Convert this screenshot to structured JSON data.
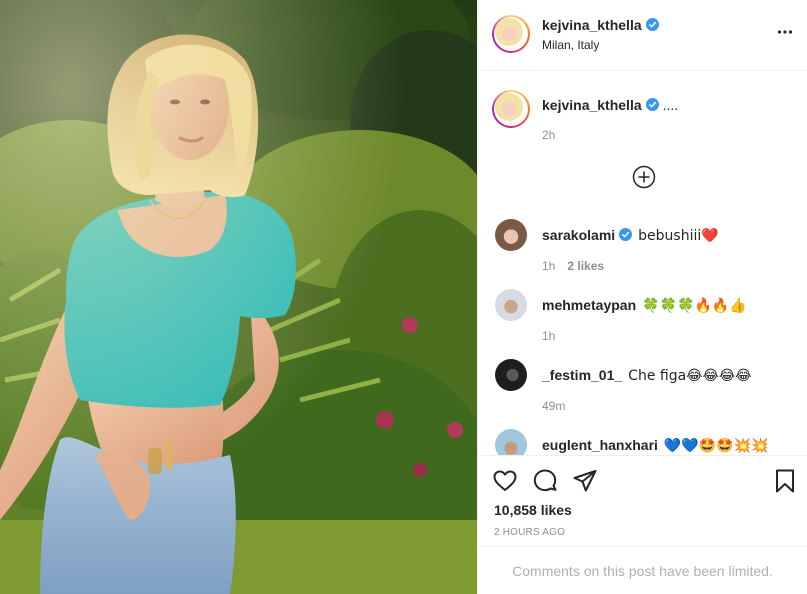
{
  "post": {
    "author": {
      "username": "kejvina_kthella",
      "location": "Milan, Italy",
      "verified": true
    },
    "caption": {
      "text": "....",
      "time": "2h"
    },
    "comments": [
      {
        "username": "sarakolami",
        "verified": true,
        "text": "bebushiii❤️",
        "time": "1h",
        "likes": "2 likes"
      },
      {
        "username": "mehmetaypan",
        "verified": false,
        "text": "🍀🍀🍀🔥🔥👍",
        "time": "1h",
        "likes": ""
      },
      {
        "username": "_festim_01_",
        "verified": false,
        "text": "Che figa😂😂😂😂",
        "time": "49m",
        "likes": ""
      },
      {
        "username": "euglent_hanxhari",
        "verified": false,
        "text": "💙💙🤩🤩💥💥",
        "time": "",
        "likes": ""
      }
    ],
    "likes_count": "10,858 likes",
    "time_ago": "2 HOURS AGO",
    "comments_limited": "Comments on this post have been limited."
  },
  "icons": {
    "verified": "verified-badge-icon",
    "more": "more-options-icon",
    "load_more": "plus-circle-icon",
    "like": "heart-icon",
    "comment": "comment-icon",
    "share": "paper-plane-icon",
    "save": "bookmark-icon"
  },
  "colors": {
    "verified": "#3897f0",
    "text": "#262626",
    "muted": "#8e8e8e",
    "crop_top": "#2fbab7"
  }
}
